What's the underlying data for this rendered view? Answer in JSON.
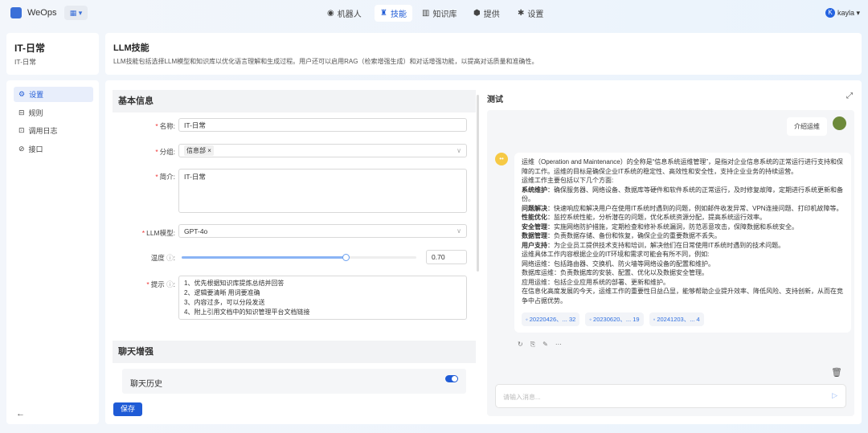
{
  "app": {
    "name": "WeOps",
    "user": "kayla",
    "user_initial": "K"
  },
  "nav": [
    {
      "label": "机器人"
    },
    {
      "label": "技能"
    },
    {
      "label": "知识库"
    },
    {
      "label": "提供"
    },
    {
      "label": "设置"
    }
  ],
  "skill": {
    "title": "IT-日常",
    "subtitle": "IT-日常"
  },
  "header": {
    "title": "LLM技能",
    "desc": "LLM技能包括选择LLM模型和知识库以优化语言理解和生成过程。用户还可以启用RAG（检索增强生成）和对话增强功能，以提高对话质量和准确性。"
  },
  "sidebar": [
    {
      "label": "设置"
    },
    {
      "label": "规则"
    },
    {
      "label": "调用日志"
    },
    {
      "label": "接口"
    }
  ],
  "form": {
    "section_basic": "基本信息",
    "name_label": "名称:",
    "name_value": "IT-日常",
    "group_label": "分组:",
    "group_tag": "信息部",
    "intro_label": "简介:",
    "intro_value": "IT-日常",
    "model_label": "LLM模型:",
    "model_value": "GPT-4o",
    "temp_label": "温度",
    "temp_value": "0.70",
    "temp_fraction": 0.7,
    "prompt_label": "提示",
    "prompt_lines": [
      "1、优先根据知识库提炼总结并回答",
      "2、逻辑要清晰 用词要准确",
      "3、内容过多，可以分段发送",
      "4、附上引用文档中的知识管理平台文档链接"
    ],
    "section_chat": "聊天增强",
    "history_label": "聊天历史",
    "history_on": true,
    "save": "保存"
  },
  "test": {
    "title": "测试",
    "user_msg": "介绍运维",
    "reply": [
      {
        "b": "",
        "t": "运维（Operation and Maintenance）的全称是“信息系统运维管理”，是指对企业信息系统的正常运行进行支持和保障的工作。运维的目标是确保企业IT系统的稳定性、高效性和安全性，支持企业业务的持续运营。"
      },
      {
        "b": "",
        "t": "运维工作主要包括以下几个方面:"
      },
      {
        "b": "系统维护",
        "t": "：确保服务器、网络设备、数据库等硬件和软件系统的正常运行，及时修复故障，定期进行系统更新和备份。"
      },
      {
        "b": "问题解决",
        "t": "：快速响应和解决用户在使用IT系统时遇到的问题，例如邮件收发异常、VPN连接问题、打印机故障等。"
      },
      {
        "b": "性能优化",
        "t": "：监控系统性能，分析潜在的问题，优化系统资源分配，提高系统运行效率。"
      },
      {
        "b": "安全管理",
        "t": "：实施网络防护措施，定期检查和修补系统漏洞，防范恶意攻击，保障数据和系统安全。"
      },
      {
        "b": "数据管理",
        "t": "：负责数据存储、备份和恢复，确保企业的重要数据不丢失。"
      },
      {
        "b": "用户支持",
        "t": "：为企业员工提供技术支持和培训，解决他们在日常使用IT系统时遇到的技术问题。"
      },
      {
        "b": "",
        "t": "运维具体工作内容根据企业的IT环境和需求可能会有所不同，例如:"
      },
      {
        "b": "",
        "t": "网络运维：包括路由器、交换机、防火墙等网络设备的配置和维护。"
      },
      {
        "b": "",
        "t": "数据库运维：负责数据库的安装、配置、优化以及数据安全管理。"
      },
      {
        "b": "",
        "t": "应用运维：包括企业应用系统的部署、更新和维护。"
      },
      {
        "b": "",
        "t": "在信息化高度发展的今天，运维工作的重要性日益凸显，能够帮助企业提升效率、降低风险、支持创新，从而在竞争中占据优势。"
      }
    ],
    "refs": [
      "20220426、... 32",
      "20230620、... 19",
      "20241203、... 4"
    ],
    "input_placeholder": "请输入消息..."
  }
}
